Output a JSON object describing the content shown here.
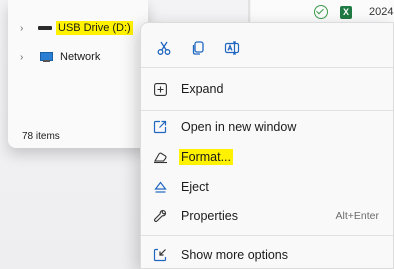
{
  "explorer": {
    "nav_items": [
      {
        "label": "USB Drive (D:)",
        "icon": "usb-drive-icon",
        "highlighted": true
      },
      {
        "label": "Network",
        "icon": "network-icon",
        "highlighted": false
      }
    ],
    "item_count": "78 items",
    "file_date": "2024"
  },
  "context_menu": {
    "quick_actions": [
      {
        "name": "cut-icon"
      },
      {
        "name": "copy-icon"
      },
      {
        "name": "rename-icon"
      }
    ],
    "items": [
      {
        "label": "Expand",
        "icon": "expand-icon",
        "shortcut": ""
      },
      {
        "label": "Open in new window",
        "icon": "open-new-window-icon",
        "shortcut": ""
      },
      {
        "label": "Format...",
        "icon": "format-icon",
        "shortcut": "",
        "highlighted": true
      },
      {
        "label": "Eject",
        "icon": "eject-icon",
        "shortcut": ""
      },
      {
        "label": "Properties",
        "icon": "wrench-icon",
        "shortcut": "Alt+Enter"
      },
      {
        "label": "Show more options",
        "icon": "show-more-icon",
        "shortcut": ""
      }
    ]
  },
  "colors": {
    "highlight": "#fff200",
    "accent": "#2167c0"
  }
}
